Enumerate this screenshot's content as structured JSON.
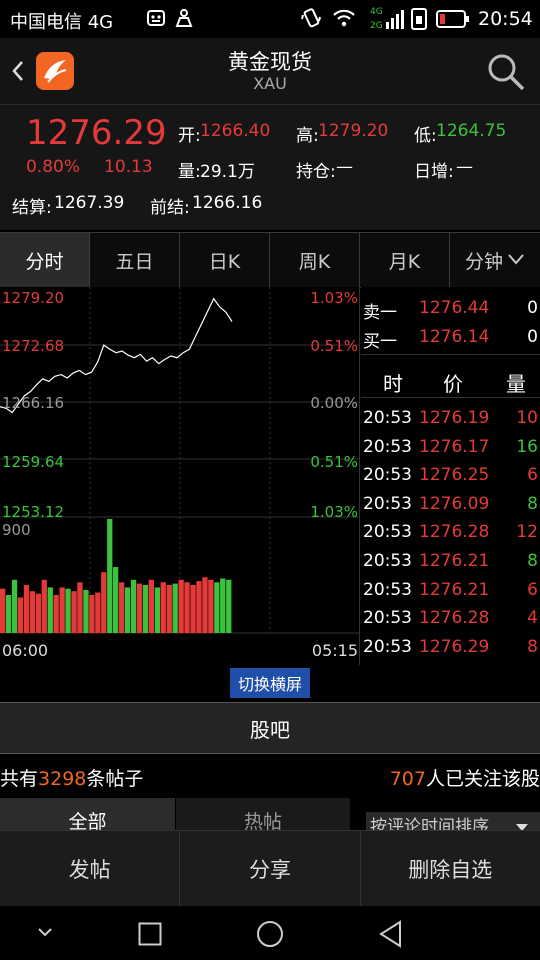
{
  "status_bar": {
    "carrier": "中国电信 4G",
    "time": "20:54"
  },
  "header": {
    "title": "黄金现货",
    "subtitle": "XAU"
  },
  "quote": {
    "price": "1276.29",
    "change_pct": "0.80%",
    "change": "10.13",
    "open_label": "开:",
    "open": "1266.40",
    "high_label": "高:",
    "high": "1279.20",
    "low_label": "低:",
    "low": "1264.75",
    "volume_label": "量:",
    "volume": "29.1万",
    "position_label": "持仓:",
    "position": "—",
    "daily_inc_label": "日增:",
    "daily_inc": "—",
    "settle_label": "结算:",
    "settle": "1267.39",
    "prev_settle_label": "前结:",
    "prev_settle": "1266.16"
  },
  "tabs": [
    {
      "label": "分时"
    },
    {
      "label": "五日"
    },
    {
      "label": "日K"
    },
    {
      "label": "周K"
    },
    {
      "label": "月K"
    },
    {
      "label": "分钟"
    }
  ],
  "chart": {
    "price_labels": [
      "1279.20",
      "1272.68",
      "1266.16",
      "1259.64",
      "1253.12"
    ],
    "pct_labels": [
      "1.03%",
      "0.51%",
      "0.00%",
      "0.51%",
      "1.03%"
    ],
    "volume_max": "900",
    "time_start": "06:00",
    "time_end": "05:15"
  },
  "chart_data": {
    "type": "line",
    "title": "",
    "xlabel": "",
    "ylabel": "",
    "x_range": [
      "06:00",
      "05:15"
    ],
    "ylim": [
      1253.12,
      1279.2
    ],
    "grid": true,
    "series": [
      {
        "values": [
          1266.2,
          1266.0,
          1265.5,
          1266.5,
          1267.5,
          1268.0,
          1268.8,
          1269.5,
          1269.2,
          1269.8,
          1270.0,
          1269.6,
          1270.2,
          1270.5,
          1270.0,
          1270.3,
          1271.5,
          1273.5,
          1273.0,
          1272.6,
          1272.8,
          1272.3,
          1272.0,
          1272.4,
          1271.6,
          1272.0,
          1271.3,
          1271.8,
          1272.2,
          1272.0,
          1272.6,
          1273.0,
          1274.5,
          1276.0,
          1277.5,
          1279.0,
          1278.0,
          1277.4,
          1276.3
        ]
      }
    ],
    "volume_ylim": [
      0,
      900
    ],
    "volume": [
      350,
      300,
      420,
      280,
      380,
      330,
      310,
      420,
      360,
      300,
      360,
      350,
      330,
      400,
      340,
      300,
      320,
      480,
      900,
      520,
      400,
      360,
      420,
      390,
      380,
      420,
      360,
      400,
      380,
      390,
      420,
      400,
      380,
      410,
      440,
      420,
      400,
      430,
      420
    ]
  },
  "order_book": {
    "sell_label": "卖一",
    "sell_price": "1276.44",
    "sell_vol": "0",
    "buy_label": "买一",
    "buy_price": "1276.14",
    "buy_vol": "0"
  },
  "trades": {
    "headers": [
      "时",
      "价",
      "量"
    ],
    "rows": [
      {
        "time": "20:53",
        "price": "1276.19",
        "vol": "10",
        "dir": "up"
      },
      {
        "time": "20:53",
        "price": "1276.17",
        "vol": "16",
        "dir": "down"
      },
      {
        "time": "20:53",
        "price": "1276.25",
        "vol": "6",
        "dir": "up"
      },
      {
        "time": "20:53",
        "price": "1276.09",
        "vol": "8",
        "dir": "down"
      },
      {
        "time": "20:53",
        "price": "1276.28",
        "vol": "12",
        "dir": "up"
      },
      {
        "time": "20:53",
        "price": "1276.21",
        "vol": "8",
        "dir": "down"
      },
      {
        "time": "20:53",
        "price": "1276.21",
        "vol": "6",
        "dir": "up"
      },
      {
        "time": "20:53",
        "price": "1276.28",
        "vol": "4",
        "dir": "up"
      },
      {
        "time": "20:53",
        "price": "1276.29",
        "vol": "8",
        "dir": "up"
      }
    ]
  },
  "switch_landscape": "切换横屏",
  "guba": "股吧",
  "posts": {
    "prefix": "共有",
    "count": "3298",
    "suffix": "条帖子",
    "followers": "707",
    "followers_suffix": "人已关注该股"
  },
  "sub_tabs": {
    "all": "全部",
    "hot": "热帖"
  },
  "sort_label": "按评论时间排序",
  "footer": {
    "post": "发帖",
    "share": "分享",
    "remove": "删除自选"
  },
  "colors": {
    "up": "#e43a3a",
    "down": "#3cc23c",
    "accent": "#f26522",
    "highlight": "#1f4fa8"
  }
}
